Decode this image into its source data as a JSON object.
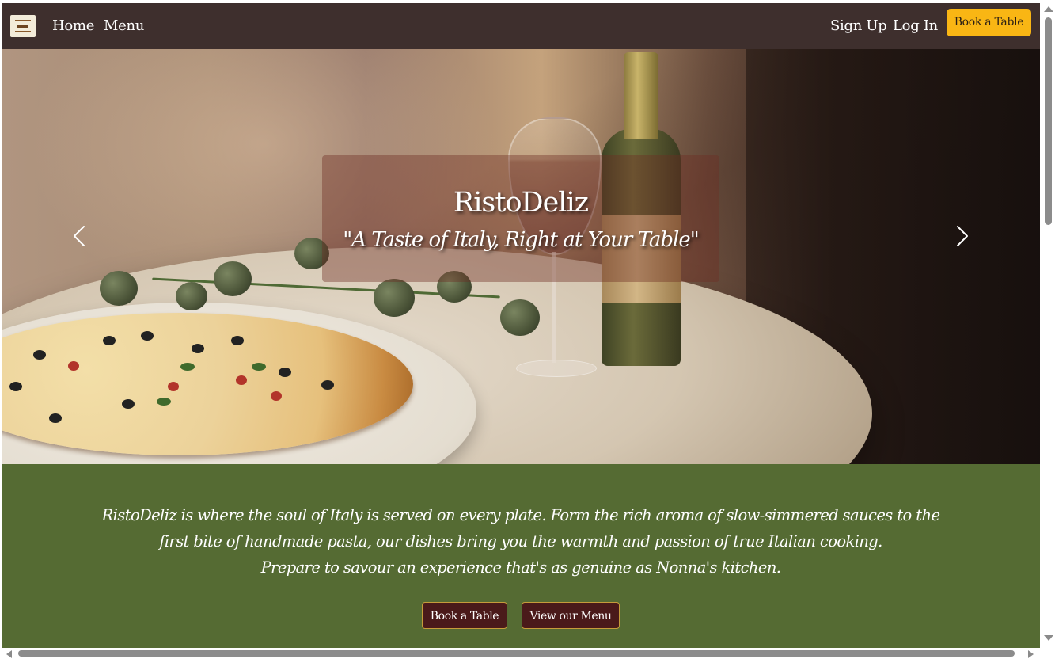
{
  "nav": {
    "home": "Home",
    "menu": "Menu",
    "sign_up": "Sign Up",
    "log_in": "Log In",
    "book_table": "Book a Table"
  },
  "hero": {
    "title": "RistoDeliz",
    "tagline": "\"A Taste of Italy, Right at Your Table\""
  },
  "intro": {
    "text_line1": "RistoDeliz is where the soul of Italy is served on every plate. Form the rich aroma of slow-simmered sauces to the",
    "text_line2": "first bite of handmade pasta, our dishes bring you the warmth and passion of true Italian cooking.",
    "text_line3": "Prepare to savour an experience that's as genuine as Nonna's kitchen.",
    "book_button": "Book a Table",
    "menu_button": "View our Menu"
  },
  "colors": {
    "navbar_bg": "#3e2f2d",
    "accent_yellow": "#f9b614",
    "intro_bg": "#556b33",
    "button_bg": "#4a1a1a",
    "button_border": "#c69c3a"
  },
  "icons": {
    "logo": "restaurant-logo",
    "prev": "chevron-left-icon",
    "next": "chevron-right-icon"
  }
}
